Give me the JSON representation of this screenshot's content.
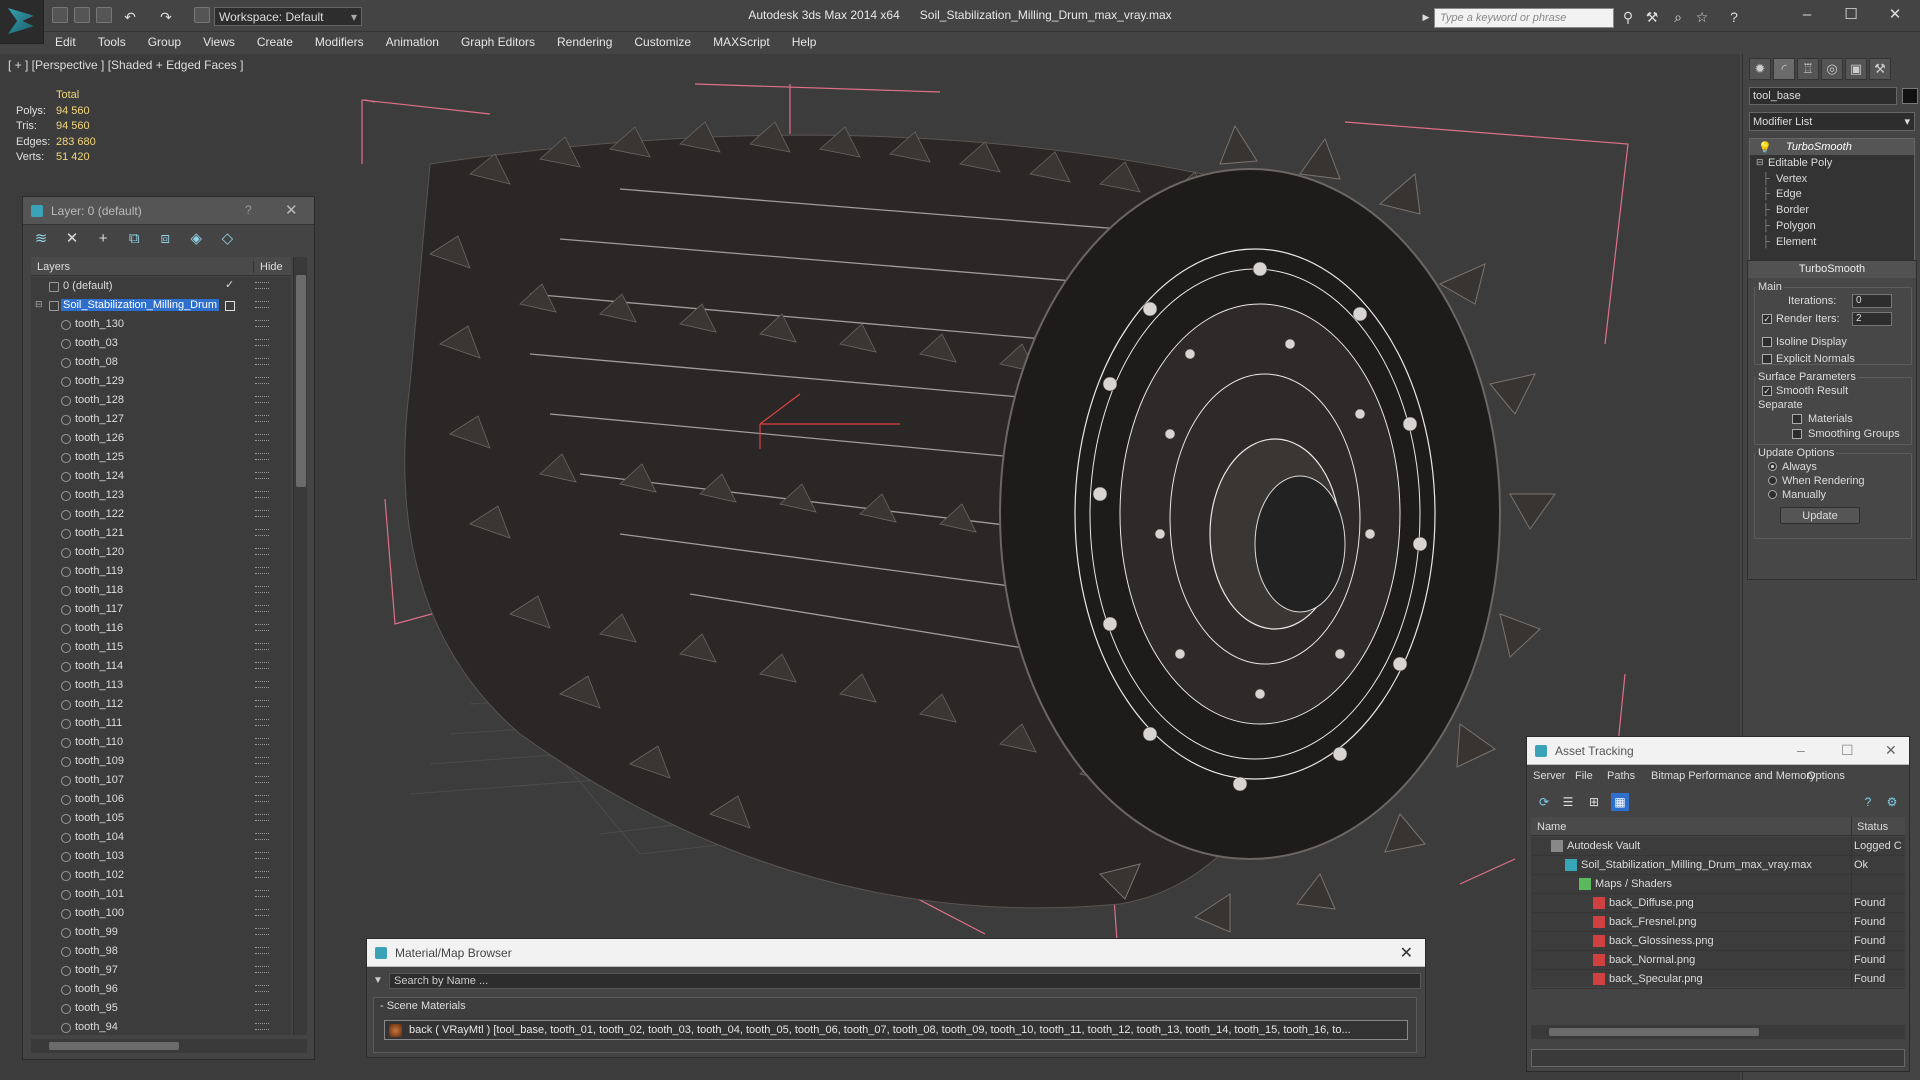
{
  "app": {
    "name": "Autodesk 3ds Max  2014 x64",
    "file": "Soil_Stabilization_Milling_Drum_max_vray.max",
    "workspace": "Workspace: Default",
    "search_placeholder": "Type a keyword or phrase"
  },
  "menu": [
    "Edit",
    "Tools",
    "Group",
    "Views",
    "Create",
    "Modifiers",
    "Animation",
    "Graph Editors",
    "Rendering",
    "Customize",
    "MAXScript",
    "Help"
  ],
  "viewport": {
    "label": "[ + ] [Perspective ] [Shaded + Edged Faces ]",
    "stats": {
      "header": "Total",
      "rows": [
        {
          "k": "Polys:",
          "v": "94 560"
        },
        {
          "k": "Tris:",
          "v": "94 560"
        },
        {
          "k": "Edges:",
          "v": "283 680"
        },
        {
          "k": "Verts:",
          "v": "51 420"
        }
      ]
    }
  },
  "layer_panel": {
    "title": "Layer: 0 (default)",
    "help": "?",
    "col_layers": "Layers",
    "col_hide": "Hide",
    "default_layer": "0 (default)",
    "selected_layer": "Soil_Stabilization_Milling_Drum",
    "items": [
      "tooth_130",
      "tooth_03",
      "tooth_08",
      "tooth_129",
      "tooth_128",
      "tooth_127",
      "tooth_126",
      "tooth_125",
      "tooth_124",
      "tooth_123",
      "tooth_122",
      "tooth_121",
      "tooth_120",
      "tooth_119",
      "tooth_118",
      "tooth_117",
      "tooth_116",
      "tooth_115",
      "tooth_114",
      "tooth_113",
      "tooth_112",
      "tooth_111",
      "tooth_110",
      "tooth_109",
      "tooth_107",
      "tooth_106",
      "tooth_105",
      "tooth_104",
      "tooth_103",
      "tooth_102",
      "tooth_101",
      "tooth_100",
      "tooth_99",
      "tooth_98",
      "tooth_97",
      "tooth_96",
      "tooth_95",
      "tooth_94"
    ]
  },
  "command_panel": {
    "object_name": "tool_base",
    "modifier_list": "Modifier List",
    "stack": [
      {
        "label": "TurboSmooth",
        "level": 0,
        "top": true
      },
      {
        "label": "Editable Poly",
        "level": 0,
        "top": false
      },
      {
        "label": "Vertex",
        "level": 1,
        "top": false
      },
      {
        "label": "Edge",
        "level": 1,
        "top": false
      },
      {
        "label": "Border",
        "level": 1,
        "top": false
      },
      {
        "label": "Polygon",
        "level": 1,
        "top": false
      },
      {
        "label": "Element",
        "level": 1,
        "top": false
      }
    ],
    "rollout": {
      "title": "TurboSmooth",
      "main": "Main",
      "iterations_label": "Iterations:",
      "iterations": "0",
      "render_iters_label": "Render Iters:",
      "render_iters": "2",
      "isoline": "Isoline Display",
      "explicit": "Explicit Normals",
      "surface": "Surface Parameters",
      "smooth_result": "Smooth Result",
      "separate": "Separate",
      "materials": "Materials",
      "smoothing_groups": "Smoothing Groups",
      "update_options": "Update Options",
      "always": "Always",
      "when_rendering": "When Rendering",
      "manually": "Manually",
      "update_button": "Update"
    }
  },
  "material_browser": {
    "title": "Material/Map Browser",
    "search_placeholder": "Search by Name ...",
    "group": "- Scene Materials",
    "item": "back  ( VRayMtl )  [tool_base, tooth_01, tooth_02, tooth_03, tooth_04, tooth_05, tooth_06, tooth_07, tooth_08, tooth_09, tooth_10, tooth_11, tooth_12, tooth_13, tooth_14, tooth_15, tooth_16, to..."
  },
  "asset_tracking": {
    "title": "Asset Tracking",
    "menu": [
      "Server",
      "File",
      "Paths",
      "Bitmap Performance and Memory",
      "Options"
    ],
    "col_name": "Name",
    "col_status": "Status",
    "rows": [
      {
        "name": "Autodesk Vault",
        "status": "Logged C",
        "indent": 0,
        "icon": "vault-icon"
      },
      {
        "name": "Soil_Stabilization_Milling_Drum_max_vray.max",
        "status": "Ok",
        "indent": 1,
        "icon": "max-file-icon"
      },
      {
        "name": "Maps / Shaders",
        "status": "",
        "indent": 2,
        "icon": "maps-folder-icon"
      },
      {
        "name": "back_Diffuse.png",
        "status": "Found",
        "indent": 3,
        "icon": "png-file-icon"
      },
      {
        "name": "back_Fresnel.png",
        "status": "Found",
        "indent": 3,
        "icon": "png-file-icon"
      },
      {
        "name": "back_Glossiness.png",
        "status": "Found",
        "indent": 3,
        "icon": "png-file-icon"
      },
      {
        "name": "back_Normal.png",
        "status": "Found",
        "indent": 3,
        "icon": "png-file-icon"
      },
      {
        "name": "back_Specular.png",
        "status": "Found",
        "indent": 3,
        "icon": "png-file-icon"
      }
    ]
  },
  "colors": {
    "selection": "#2e6fce",
    "stats_value": "#f3d77a",
    "bbox": "#e0708a"
  }
}
